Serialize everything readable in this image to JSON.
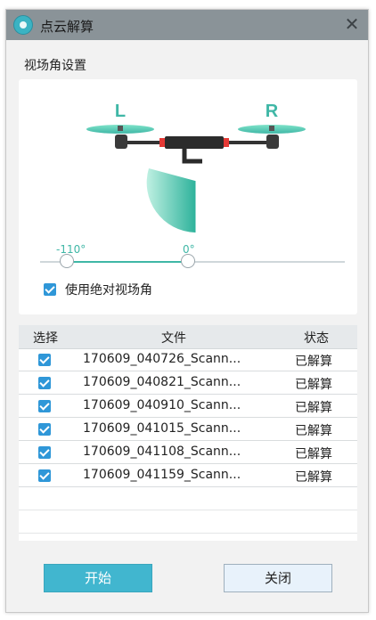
{
  "window": {
    "title": "点云解算",
    "close_glyph": "✕",
    "icon": "app-logo-icon"
  },
  "fov": {
    "section_label": "视场角设置",
    "left_label": "L",
    "right_label": "R",
    "angle_left": "-110°",
    "angle_right": "0°",
    "slider_min_value": -110,
    "slider_max_value": 0,
    "use_absolute_label": "使用绝对视场角",
    "use_absolute_checked": true,
    "accent_color": "#3fb7a6"
  },
  "table": {
    "headers": {
      "select": "选择",
      "file": "文件",
      "status": "状态"
    },
    "rows": [
      {
        "checked": true,
        "file": "170609_040726_Scann...",
        "status": "已解算"
      },
      {
        "checked": true,
        "file": "170609_040821_Scann...",
        "status": "已解算"
      },
      {
        "checked": true,
        "file": "170609_040910_Scann...",
        "status": "已解算"
      },
      {
        "checked": true,
        "file": "170609_041015_Scann...",
        "status": "已解算"
      },
      {
        "checked": true,
        "file": "170609_041108_Scann...",
        "status": "已解算"
      },
      {
        "checked": true,
        "file": "170609_041159_Scann...",
        "status": "已解算"
      }
    ]
  },
  "buttons": {
    "start_label": "开始",
    "close_label": "关闭",
    "start_color": "#41b6cf"
  }
}
